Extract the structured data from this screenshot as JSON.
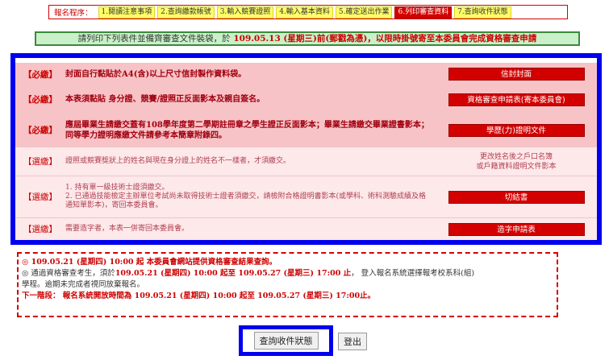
{
  "steps": {
    "label": "報名程序：",
    "items": [
      {
        "text": "1.閱讀注意事項",
        "active": false
      },
      {
        "text": "2.查詢繳款帳號",
        "active": false
      },
      {
        "text": "3.輸入競賽證照",
        "active": false
      },
      {
        "text": "4.輸入基本資料",
        "active": false
      },
      {
        "text": "5.確定送出作業",
        "active": false
      },
      {
        "text": "6.列印審查資料",
        "active": true
      },
      {
        "text": "7.查詢收件狀態",
        "active": false
      }
    ]
  },
  "notice": {
    "pre": "請列印下列表件並備齊審查文件裝袋，於",
    "main": "109.05.13 (星期三)前(郵戳為憑)，以限時掛號寄至本委員會完成資格審查申請"
  },
  "rows": [
    {
      "kind": "req",
      "tag": "【必繳】",
      "desc": "封面自行黏貼於A4(含)以上尺寸信封製作資料袋。",
      "button": "信封封面"
    },
    {
      "kind": "req",
      "tag": "【必繳】",
      "desc": "本表須黏貼 身分證、競賽/證照正反面影本及親自簽名。",
      "button": "資格審查申請表(寄本委員會)"
    },
    {
      "kind": "req",
      "tag": "【必繳】",
      "desc": "應屆畢業生請繳交蓋有108學年度第二學期註冊章之學生證正反面影本；畢業生請繳交畢業證書影本；同等學力證明應繳文件請參考本簡章附錄四。",
      "button": "學歷(力)證明文件"
    },
    {
      "kind": "opt",
      "tag": "【選繳】",
      "desc": "證照或競賽獎狀上的姓名與現在身分證上的姓名不一樣者，才須繳交。",
      "text1": "更改姓名後之戶口名簿",
      "text2": "或戶籍資料證明文件影本"
    },
    {
      "kind": "opt",
      "tag": "【選繳】",
      "desc1": "1. 持有單一級技術士證須繳交。",
      "desc2": "2. 已通過技能檢定主辦單位考試尚未取得技術士證者須繳交，請檢附合格證明書影本(或學科、術科測驗成績及格通知單影本)，寄回本委員會。",
      "button": "切結書"
    },
    {
      "kind": "opt",
      "tag": "【選繳】",
      "desc": "需要造字者，本表一併寄回本委員會。",
      "button": "造字申請表"
    }
  ],
  "info": {
    "l1": "◎  109.05.21 (星期四) 10:00 起 本委員會網站提供資格審查結果查詢。",
    "l2a": "◎ 通過資格審查考生，須於",
    "l2b": "109.05.21 (星期四) 10:00 起至 109.05.27 (星期三) 17:00 止",
    "l2c": "，  登入報名系統選擇報考校系科(組)",
    "l3": "學程。逾期未完成者視同放棄報名。",
    "l4": "下一階段： 報名系統開放時間為 109.05.21 (星期四) 10:00 起至 109.05.27 (星期三) 17:00止。"
  },
  "buttons": {
    "status": "查詢收件狀態",
    "logout": "登出"
  }
}
